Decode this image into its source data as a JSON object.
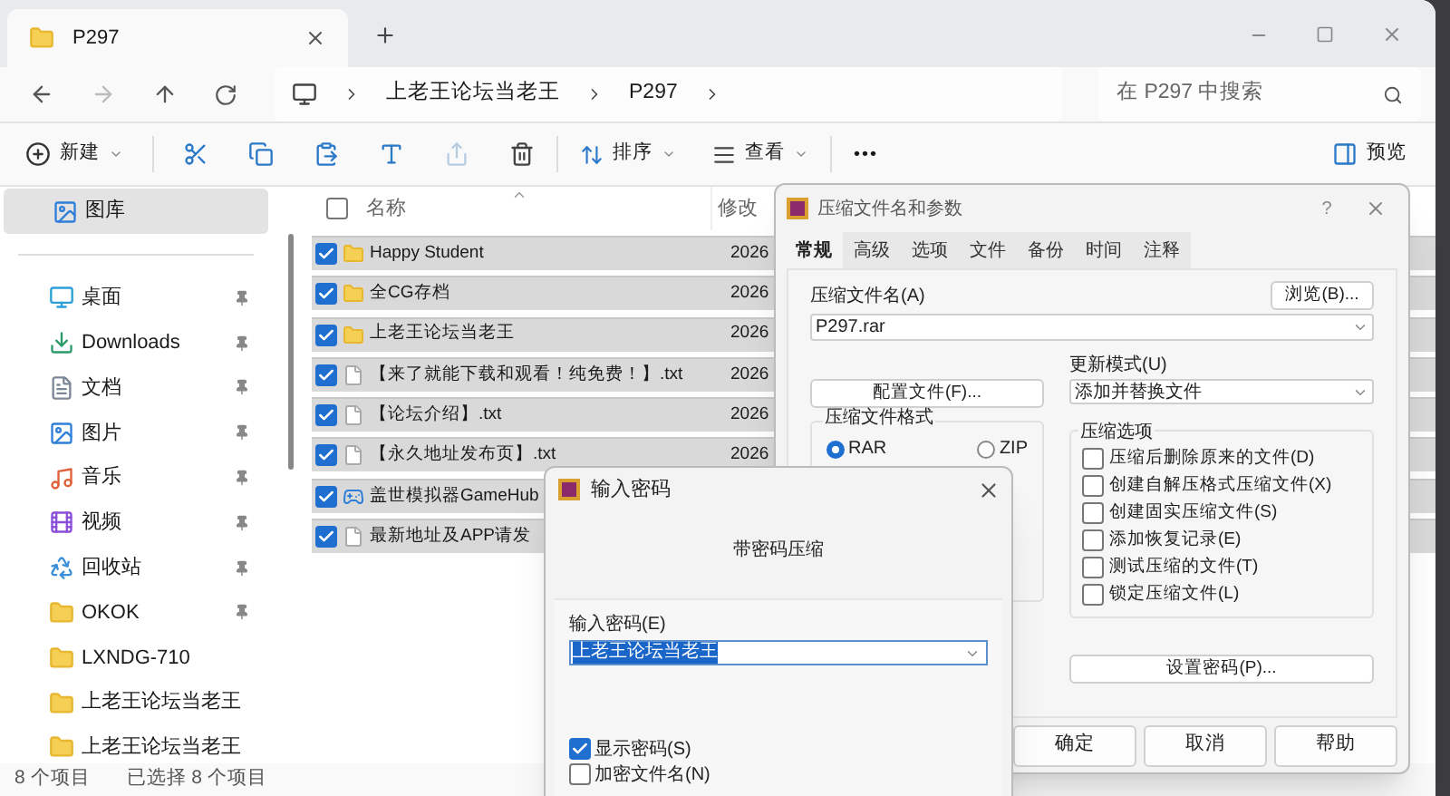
{
  "explorer": {
    "tab_title": "P297",
    "breadcrumb": [
      "上老王论坛当老王",
      "P297"
    ],
    "search": {
      "placeholder": "在 P297 中搜索"
    },
    "toolbar": {
      "new": "新建",
      "sort": "排序",
      "view": "查看",
      "more": "•••",
      "preview": "预览"
    },
    "sidebar": {
      "items": [
        {
          "label": "图库",
          "selected": true,
          "pinned": false
        },
        {
          "label": "桌面",
          "selected": false,
          "pinned": true
        },
        {
          "label": "Downloads",
          "selected": false,
          "pinned": true
        },
        {
          "label": "文档",
          "selected": false,
          "pinned": true
        },
        {
          "label": "图片",
          "selected": false,
          "pinned": true
        },
        {
          "label": "音乐",
          "selected": false,
          "pinned": true
        },
        {
          "label": "视频",
          "selected": false,
          "pinned": true
        },
        {
          "label": "回收站",
          "selected": false,
          "pinned": true
        },
        {
          "label": "OKOK",
          "selected": false,
          "pinned": true
        },
        {
          "label": "LXNDG-710",
          "selected": false,
          "pinned": false
        },
        {
          "label": "上老王论坛当老王",
          "selected": false,
          "pinned": false
        },
        {
          "label": "上老王论坛当老王",
          "selected": false,
          "pinned": false
        }
      ]
    },
    "select_all": {
      "checked": false
    },
    "columns": [
      "名称",
      "修改"
    ],
    "files": [
      {
        "name": "Happy Student",
        "kind": "folder",
        "date": "2026",
        "checked": true
      },
      {
        "name": "全CG存档",
        "kind": "folder",
        "date": "2026",
        "checked": true
      },
      {
        "name": "上老王论坛当老王",
        "kind": "folder",
        "date": "2026",
        "checked": true
      },
      {
        "name": "【来了就能下载和观看！纯免费！】.txt",
        "kind": "text",
        "date": "2026",
        "checked": true
      },
      {
        "name": "【论坛介绍】.txt",
        "kind": "text",
        "date": "2026",
        "checked": true
      },
      {
        "name": "【永久地址发布页】.txt",
        "kind": "text",
        "date": "2026",
        "checked": true
      },
      {
        "name": "盖世模拟器GameHub",
        "kind": "app",
        "checked": true
      },
      {
        "name": "最新地址及APP请发",
        "kind": "text",
        "checked": true
      }
    ],
    "status_bar": {
      "count": "8 个项目",
      "selected": "已选择 8 个项目"
    }
  },
  "archive_dialog": {
    "title": "压缩文件名和参数",
    "help": "?",
    "tabs": [
      {
        "label": "常规",
        "selected": true
      },
      {
        "label": "高级",
        "selected": false
      },
      {
        "label": "选项",
        "selected": false
      },
      {
        "label": "文件",
        "selected": false
      },
      {
        "label": "备份",
        "selected": false
      },
      {
        "label": "时间",
        "selected": false
      },
      {
        "label": "注释",
        "selected": false
      }
    ],
    "archive_name_label": "压缩文件名(A)",
    "browse": "浏览(B)...",
    "archive_name": "P297.rar",
    "update_mode_label": "更新模式(U)",
    "update_mode": "添加并替换文件",
    "profiles": "配置文件(F)...",
    "format_group": "压缩文件格式",
    "formats": [
      {
        "label": "RAR",
        "selected": true
      },
      {
        "label": "ZIP",
        "selected": false
      }
    ],
    "options_group": "压缩选项",
    "options": [
      {
        "label": "压缩后删除原来的文件(D)",
        "checked": false
      },
      {
        "label": "创建自解压格式压缩文件(X)",
        "checked": false
      },
      {
        "label": "创建固实压缩文件(S)",
        "checked": false
      },
      {
        "label": "添加恢复记录(E)",
        "checked": false
      },
      {
        "label": "测试压缩的文件(T)",
        "checked": false
      },
      {
        "label": "锁定压缩文件(L)",
        "checked": false
      }
    ],
    "set_password": "设置密码(P)...",
    "buttons": [
      "确定",
      "取消",
      "帮助"
    ]
  },
  "password_dialog": {
    "title": "输入密码",
    "subtitle": "带密码压缩",
    "label": "输入密码(E)",
    "value": "上老王论坛当老王",
    "text_selected": true,
    "checkboxes": [
      {
        "label": "显示密码(S)",
        "checked": true
      },
      {
        "label": "加密文件名(N)",
        "checked": false
      }
    ]
  }
}
